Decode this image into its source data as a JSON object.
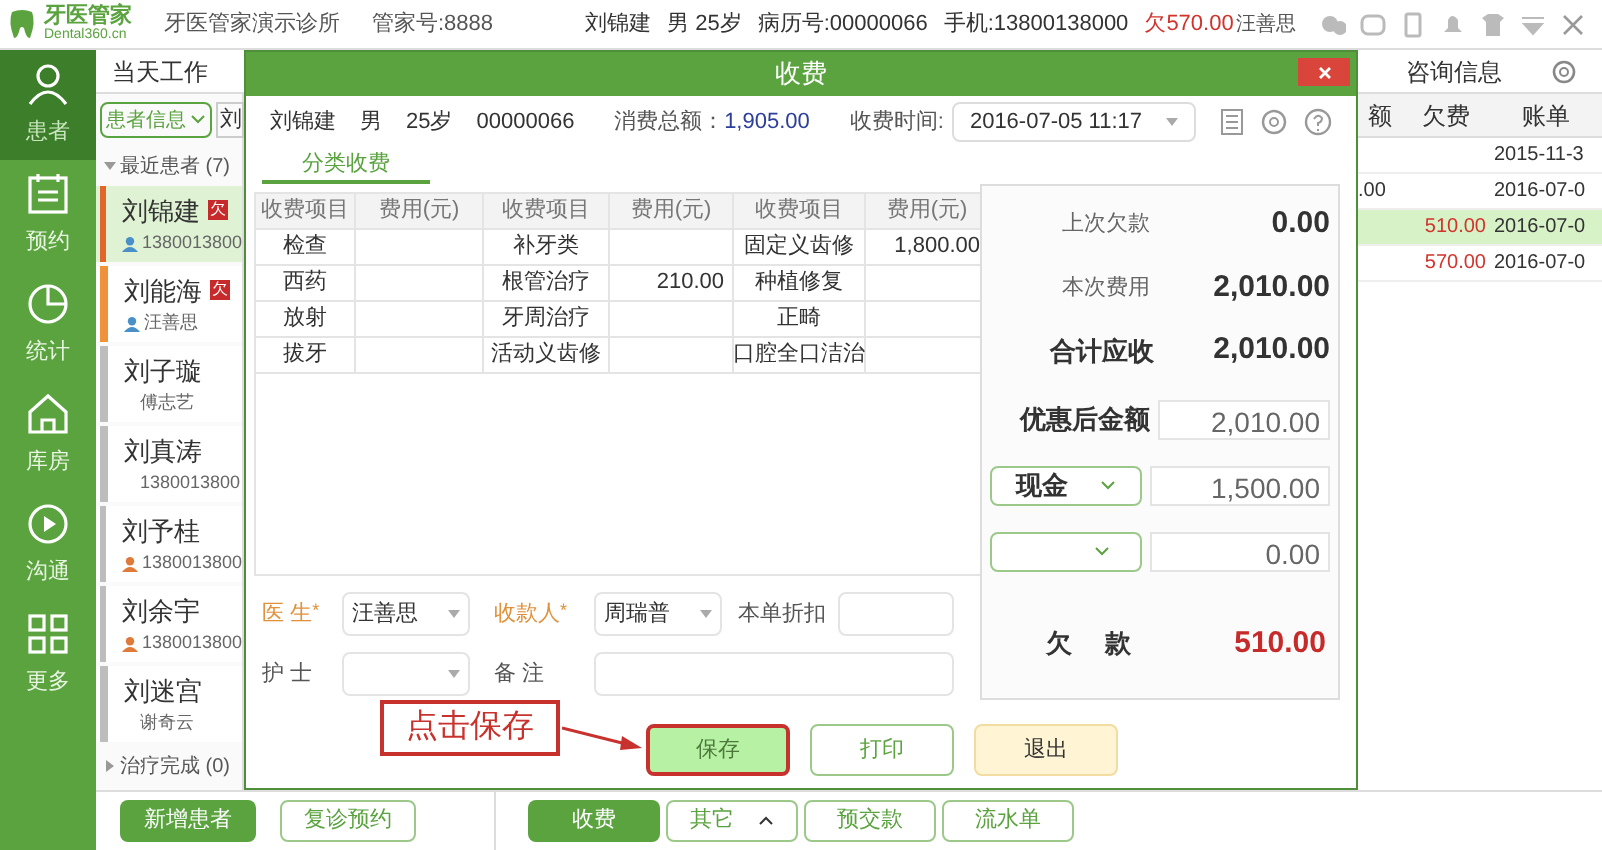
{
  "app": {
    "logo_name": "牙医管家",
    "logo_domain": "Dental360.cn",
    "clinic": "牙医管家演示诊所",
    "account": "管家号:8888",
    "patient_name": "刘锦建",
    "patient_sex_age": "男 25岁",
    "record_no": "病历号:00000066",
    "phone": "手机:13800138000",
    "owed": "欠570.00",
    "user": "汪善思"
  },
  "sidebar": [
    {
      "label": "患者",
      "selected": true
    },
    {
      "label": "预约",
      "selected": false
    },
    {
      "label": "统计",
      "selected": false
    },
    {
      "label": "库房",
      "selected": false
    },
    {
      "label": "沟通",
      "selected": false
    },
    {
      "label": "更多",
      "selected": false
    }
  ],
  "tabs": [
    {
      "label": "当天工作",
      "selected": false
    },
    {
      "label": "咨询信息",
      "selected": false
    }
  ],
  "filter": {
    "value": "患者信息"
  },
  "search": {
    "value": "刘"
  },
  "groups": [
    {
      "label": "最近患者 (7)",
      "expanded": true,
      "patients": [
        {
          "name": "刘锦建",
          "badge": "欠",
          "sub": "1380013800",
          "kind": "male",
          "color": "#e0662a",
          "selected": true
        },
        {
          "name": "刘能海",
          "badge": "欠",
          "sub": "汪善思",
          "kind": "male",
          "color": "#f0923a",
          "selected": false
        },
        {
          "name": "刘子璇",
          "sub": "傅志艺",
          "kind": "none",
          "color": "#bdbdbd",
          "selected": false
        },
        {
          "name": "刘真涛",
          "sub": "1380013800",
          "kind": "none",
          "color": "#bdbdbd",
          "selected": false
        },
        {
          "name": "刘予桂",
          "sub": "1380013800",
          "kind": "female",
          "color": "#bdbdbd",
          "selected": false
        },
        {
          "name": "刘余宇",
          "sub": "1380013800",
          "kind": "female",
          "color": "#bdbdbd",
          "selected": false
        },
        {
          "name": "刘迷宫",
          "sub": "谢奇云",
          "kind": "none",
          "color": "#bdbdbd",
          "selected": false
        }
      ]
    },
    {
      "label": "治疗完成 (0)",
      "expanded": false
    }
  ],
  "bills": {
    "columns": [
      "额",
      "欠费",
      "账单"
    ],
    "rows": [
      {
        "cells": [
          "",
          "",
          "2015-11-3"
        ],
        "selected": false
      },
      {
        "cells": [
          ".00",
          "",
          "2016-07-0"
        ],
        "selected": false
      },
      {
        "cells": [
          "",
          "510.00",
          "2016-07-0"
        ],
        "selected": true
      },
      {
        "cells": [
          "",
          "570.00",
          "2016-07-0"
        ],
        "selected": false
      }
    ]
  },
  "dialog": {
    "title": "收费",
    "patient": [
      "刘锦建",
      "男",
      "25岁",
      "00000066"
    ],
    "total_label": "消费总额：",
    "total": "1,905.00",
    "time_label": "收费时间:",
    "time": "2016-07-05  11:17",
    "tabs": [
      {
        "label": "分类收费",
        "selected": true
      }
    ],
    "columns": [
      "收费项目",
      "费用(元)",
      "收费项目",
      "费用(元)",
      "收费项目",
      "费用(元)"
    ],
    "rows": [
      [
        "检查",
        "",
        "补牙类",
        "",
        "固定义齿修",
        "1,800.00"
      ],
      [
        "西药",
        "",
        "根管治疗",
        "210.00",
        "种植修复",
        ""
      ],
      [
        "放射",
        "",
        "牙周治疗",
        "",
        "正畸",
        ""
      ],
      [
        "拔牙",
        "",
        "活动义齿修",
        "",
        "口腔全口洁治",
        ""
      ]
    ],
    "summary": [
      {
        "label": "上次欠款",
        "value": "0.00",
        "kind": "small"
      },
      {
        "label": "本次费用",
        "value": "2,010.00",
        "kind": "small"
      },
      {
        "label": "合计应收",
        "value": "2,010.00",
        "kind": "big"
      }
    ],
    "discounted": {
      "label": "优惠后金额",
      "value": "2,010.00"
    },
    "payments": [
      {
        "method": "现金",
        "amount": "1,500.00"
      },
      {
        "amount": "0.00"
      }
    ],
    "balance": {
      "label": "欠　 款",
      "value": "510.00"
    },
    "form": [
      {
        "label": "医 生",
        "required_mark": "*",
        "kind": "select",
        "value": "汪善思"
      },
      {
        "label": "收款人",
        "required_mark": "*",
        "kind": "select",
        "value": "周瑞普"
      },
      {
        "label": "本单折扣",
        "kind": "text"
      },
      {
        "label": "护 士",
        "kind": "select"
      },
      {
        "label": "备 注",
        "kind": "wide"
      }
    ],
    "buttons": [
      {
        "label": "保存",
        "kind": "primary"
      },
      {
        "label": "打印",
        "kind": "plain"
      },
      {
        "label": "退出",
        "kind": "warn"
      }
    ],
    "callout": "点击保存"
  },
  "bottom_left": [
    {
      "label": "新增患者",
      "kind": "primary"
    },
    {
      "label": "复诊预约",
      "kind": "plain"
    }
  ],
  "bottom_right": [
    {
      "label": "收费",
      "kind": "primary"
    },
    {
      "label": "其它",
      "kind": "menu"
    },
    {
      "label": "预交款",
      "kind": "plain"
    },
    {
      "label": "流水单",
      "kind": "plain"
    }
  ]
}
